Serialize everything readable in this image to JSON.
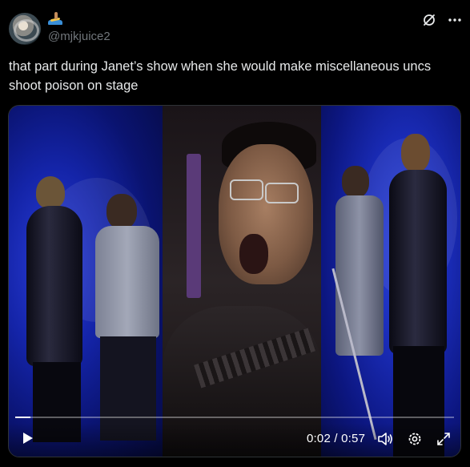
{
  "post": {
    "display_name": "",
    "name_emoji": "surfer-emoji",
    "handle": "@mjkjuice2",
    "text": "that part during Janet’s show when she would make miscellaneous uncs shoot poison on stage"
  },
  "header_icons": [
    "grok-icon",
    "more-icon"
  ],
  "video": {
    "current_time": "0:02",
    "separator": "/",
    "duration": "0:57",
    "progress_fraction": 0.035,
    "controls": [
      "play-icon",
      "volume-icon",
      "settings-icon",
      "fullscreen-icon"
    ]
  },
  "colors": {
    "background": "#000000",
    "text": "#e7e9ea",
    "muted": "#71767b",
    "stage_blue": "#1a2cb8"
  }
}
